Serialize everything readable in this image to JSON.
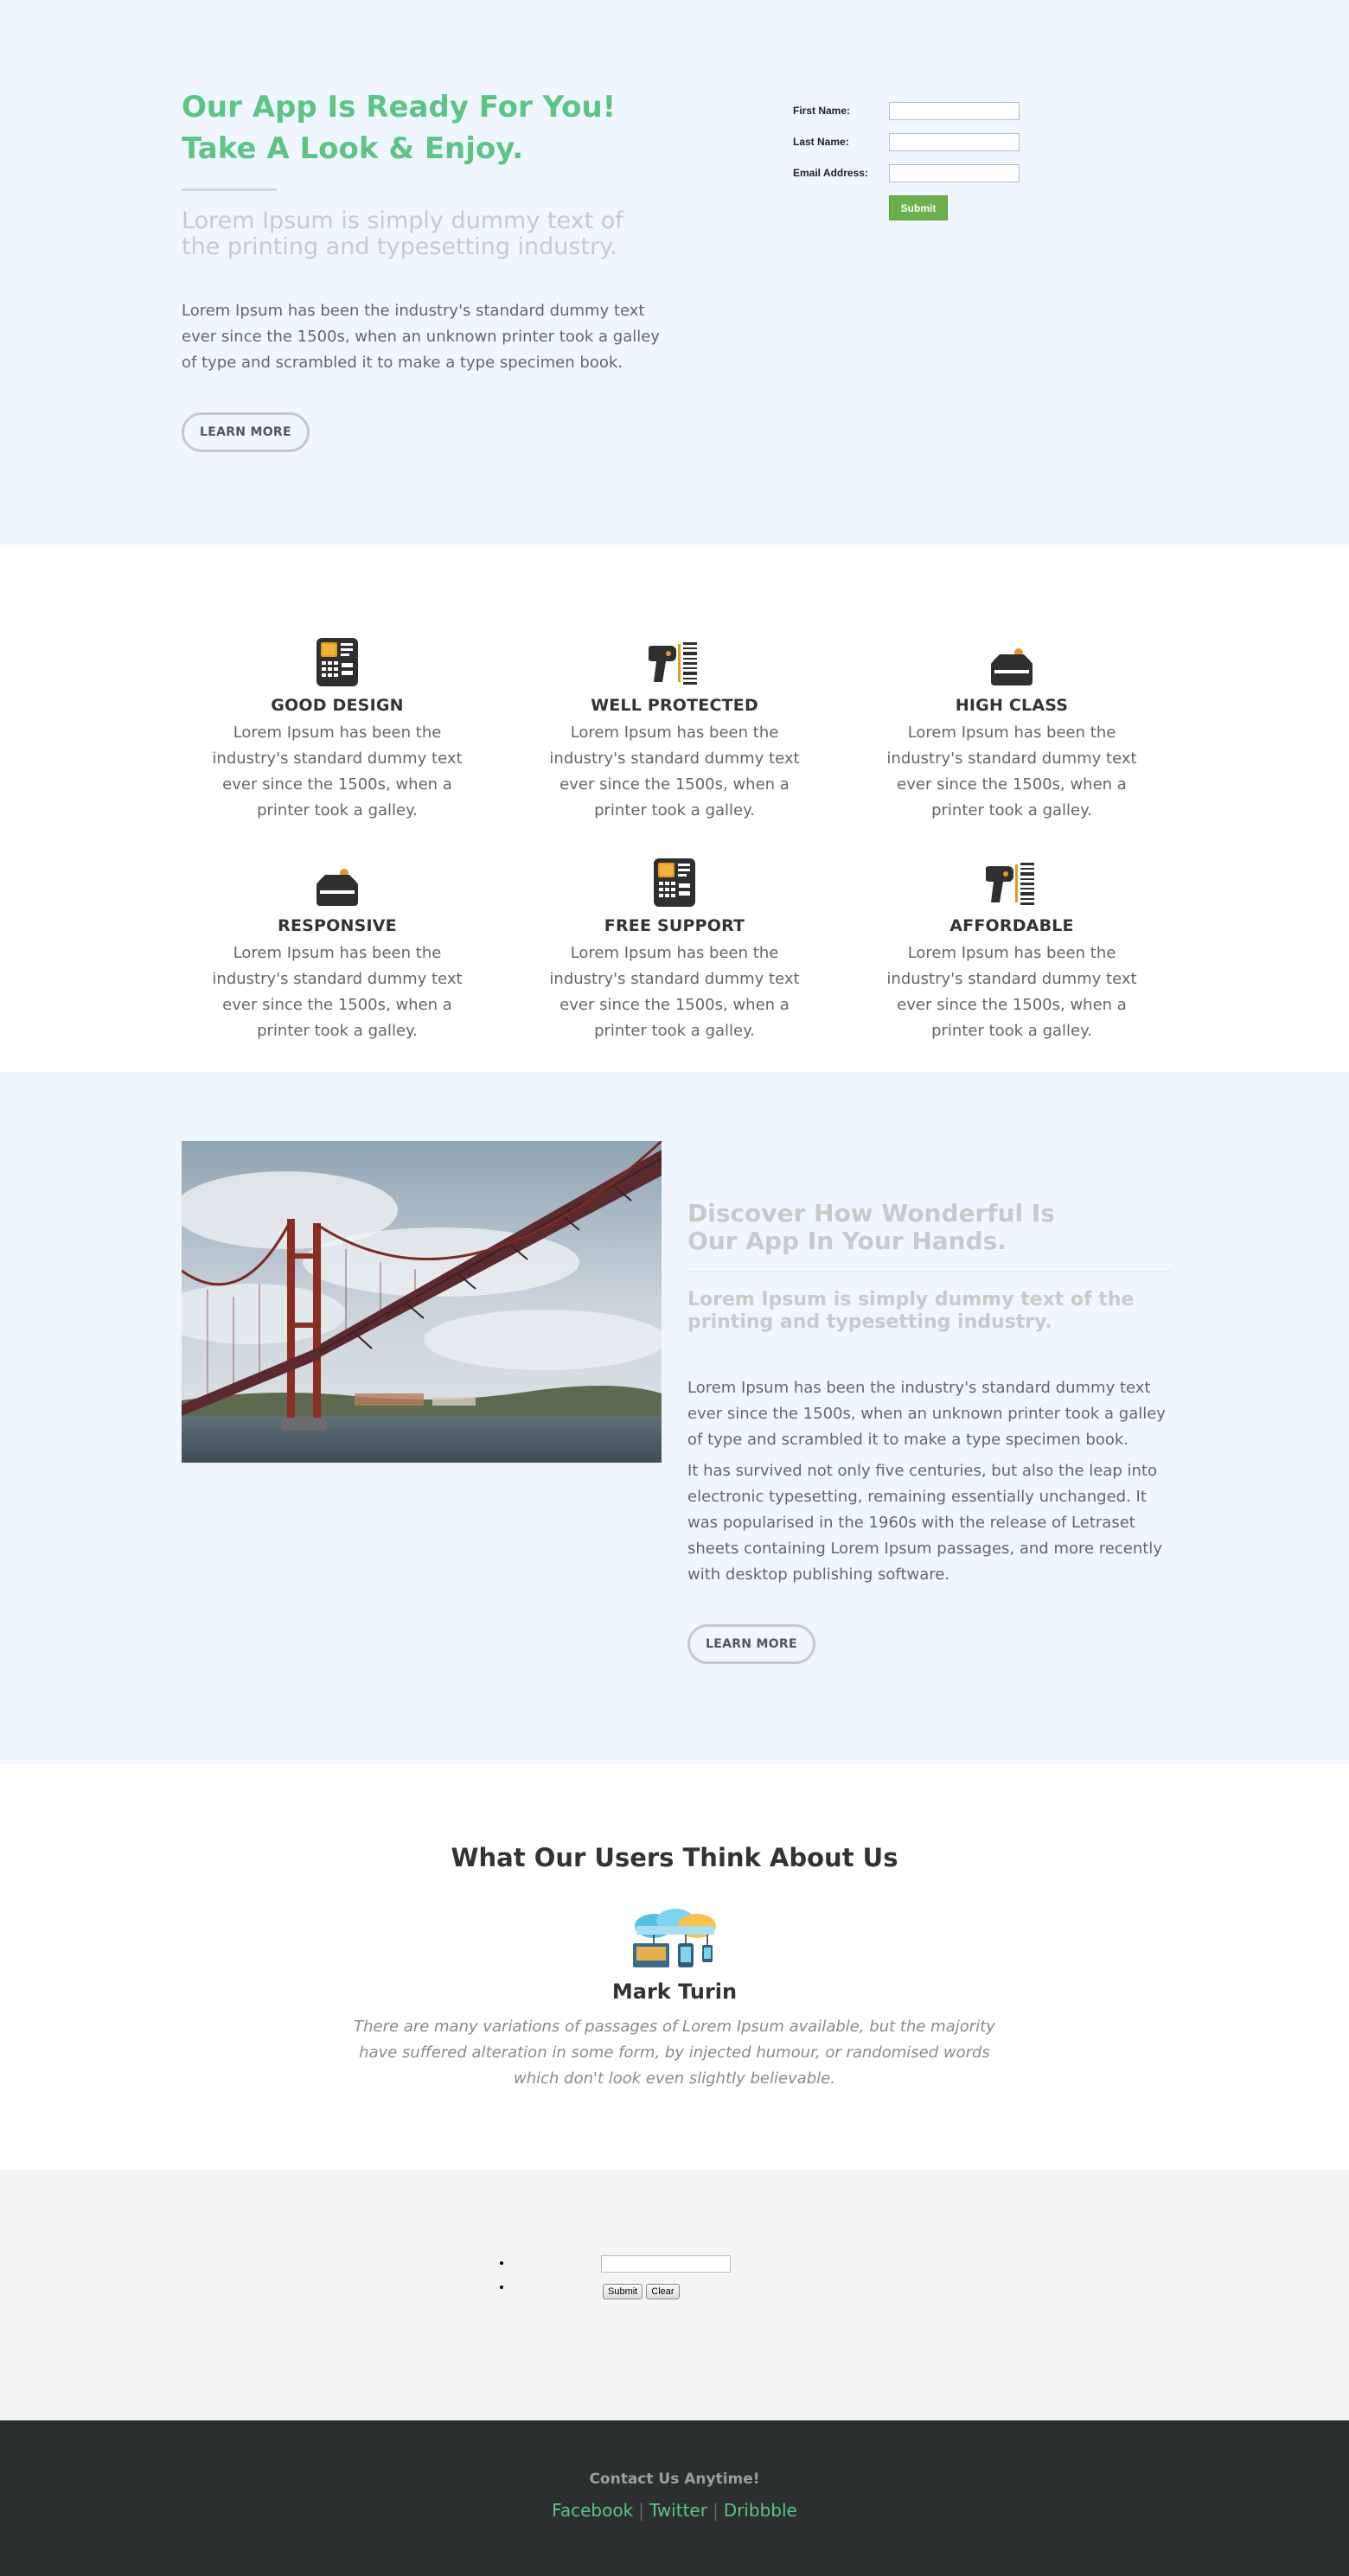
{
  "hero": {
    "title_line1": "Our App Is Ready For You!",
    "title_line2": "Take A Look & Enjoy.",
    "subtitle": "Lorem Ipsum is simply dummy text of the printing and typesetting industry.",
    "body": "Lorem Ipsum has been the industry's standard dummy text ever since the 1500s, when an unknown printer took a galley of type and scrambled it to make a type specimen book.",
    "button_label": "LEARN MORE",
    "accent_color": "#5cc586"
  },
  "signup_form": {
    "first_name_label": "First Name:",
    "last_name_label": "Last Name:",
    "email_label": "Email Address:",
    "first_name_value": "",
    "last_name_value": "",
    "email_value": "",
    "submit_label": "Submit"
  },
  "features": {
    "items": [
      {
        "title": "GOOD DESIGN",
        "body": "Lorem Ipsum has been the industry's standard dummy text ever since the 1500s, when a printer took a galley.",
        "icon": "terminal-icon"
      },
      {
        "title": "WELL PROTECTED",
        "body": "Lorem Ipsum has been the industry's standard dummy text ever since the 1500s, when a printer took a galley.",
        "icon": "barcode-scanner-icon"
      },
      {
        "title": "HIGH CLASS",
        "body": "Lorem Ipsum has been the industry's standard dummy text ever since the 1500s, when a printer took a galley.",
        "icon": "card-reader-icon"
      },
      {
        "title": "RESPONSIVE",
        "body": "Lorem Ipsum has been the industry's standard dummy text ever since the 1500s, when a printer took a galley.",
        "icon": "card-reader-icon"
      },
      {
        "title": "FREE SUPPORT",
        "body": "Lorem Ipsum has been the industry's standard dummy text ever since the 1500s, when a printer took a galley.",
        "icon": "terminal-icon"
      },
      {
        "title": "AFFORDABLE",
        "body": "Lorem Ipsum has been the industry's standard dummy text ever since the 1500s, when a printer took a galley.",
        "icon": "barcode-scanner-icon"
      }
    ]
  },
  "discover": {
    "title_line1": "Discover How Wonderful Is",
    "title_line2": "Our App In Your Hands.",
    "subtitle": "Lorem Ipsum is simply dummy text of the printing and typesetting industry.",
    "body1": "Lorem Ipsum has been the industry's standard dummy text ever since the 1500s, when an unknown printer took a galley of type and scrambled it to make a type specimen book.",
    "body2": "It has survived not only five centuries, but also the leap into electronic typesetting, remaining essentially unchanged. It was popularised in the 1960s with the release of Letraset sheets containing Lorem Ipsum passages, and more recently with desktop publishing software.",
    "button_label": "LEARN MORE",
    "image": "bridge-photo"
  },
  "testimonial": {
    "heading": "What Our Users Think About Us",
    "name": "Mark Turin",
    "quote": "There are many variations of passages of Lorem Ipsum available, but the majority have suffered alteration in some form, by injected humour, or randomised words which don't look even slightly believable.",
    "icon": "cloud-devices-icon"
  },
  "mini_form": {
    "input_value": "",
    "submit_label": "Submit",
    "clear_label": "Clear"
  },
  "footer": {
    "title": "Contact Us Anytime!",
    "links": [
      "Facebook",
      "Twitter",
      "Dribbble"
    ],
    "separator": "|"
  }
}
